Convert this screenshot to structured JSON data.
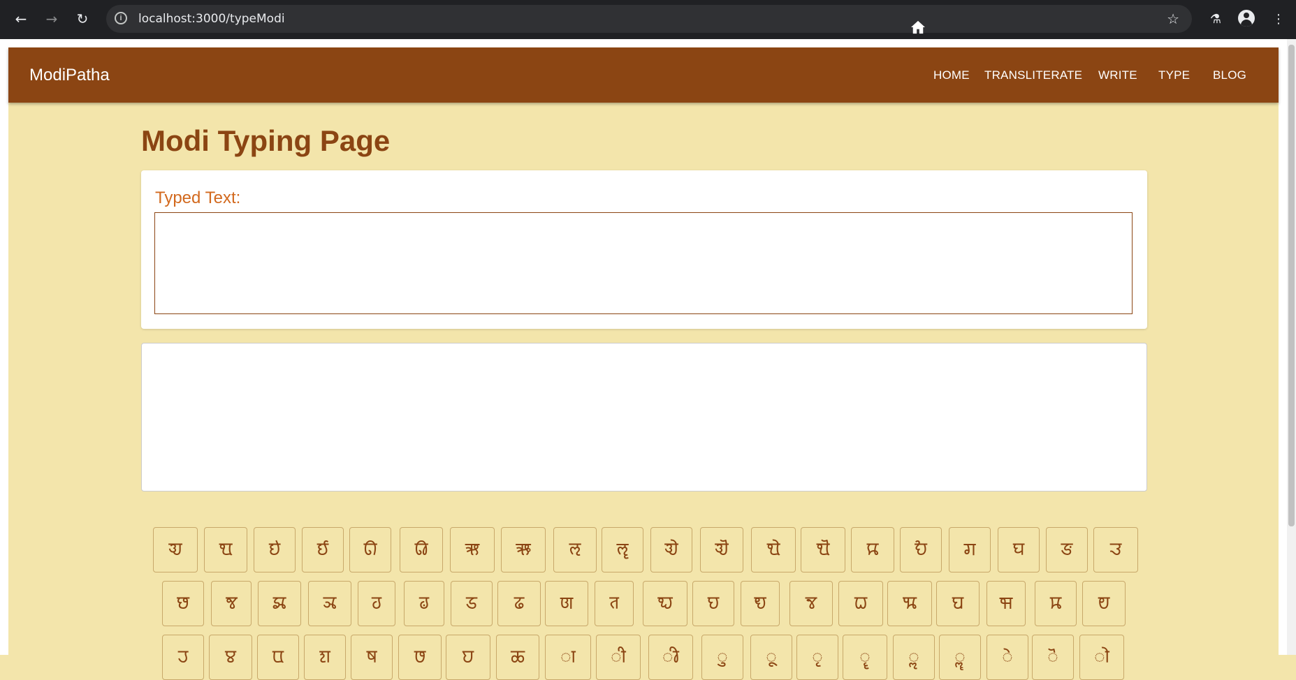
{
  "browser": {
    "url": "localhost:3000/typeModi",
    "back_icon": "arrow-left-icon",
    "forward_icon": "arrow-right-icon",
    "reload_icon": "reload-icon"
  },
  "navbar": {
    "brand": "ModiPatha",
    "links": [
      {
        "label": "HOME",
        "icon": "home-icon"
      },
      {
        "label": "TRANSLITERATE"
      },
      {
        "label": "WRITE"
      },
      {
        "label": "TYPE"
      },
      {
        "label": "BLOG"
      }
    ]
  },
  "page": {
    "title": "Modi Typing Page",
    "typed_label": "Typed Text:",
    "typed_value": "",
    "input_value": ""
  },
  "keyboard": {
    "row1": [
      "𑘀",
      "𑘁",
      "𑘂",
      "𑘃",
      "𑘄",
      "𑘅",
      "𑘆",
      "𑘇",
      "𑘈",
      "𑘉",
      "𑘊",
      "𑘋",
      "𑘌",
      "𑘍",
      "𑘎",
      "𑘏",
      "𑘐",
      "𑘑",
      "𑘒",
      "𑘓"
    ],
    "row2": [
      "𑘔",
      "𑘕",
      "𑘖",
      "𑘗",
      "𑘘",
      "𑘙",
      "𑘚",
      "𑘛",
      "𑘜",
      "𑘝",
      "𑘞",
      "𑘟",
      "𑘠",
      "𑘡",
      "𑘢",
      "𑘣",
      "𑘤",
      "𑘥",
      "𑘦",
      "𑘧"
    ],
    "row3": [
      "𑘨",
      "𑘩",
      "𑘪",
      "𑘫",
      "𑘬",
      "𑘭",
      "𑘮",
      "𑘯",
      "𑘰",
      "𑘱",
      "𑘲",
      "𑘳",
      "𑘴",
      "𑘵",
      "𑘶",
      "𑘷",
      "𑘸",
      "𑘹",
      "𑘺",
      "𑘻"
    ]
  },
  "colors": {
    "brand": "#8b4513",
    "background": "#f3e5ab",
    "label": "#d2691e"
  }
}
